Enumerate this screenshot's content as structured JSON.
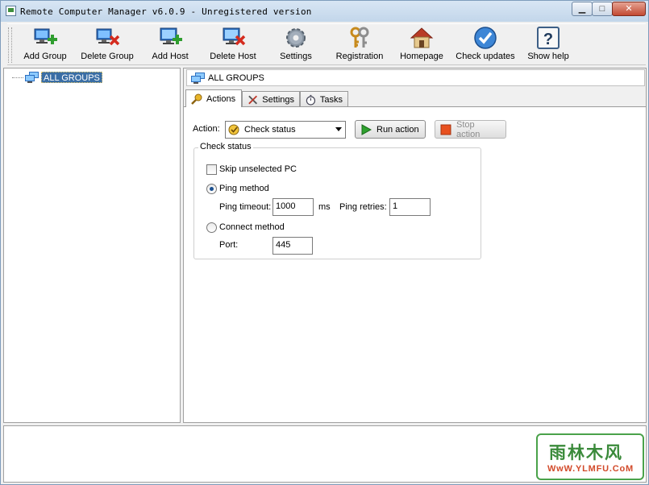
{
  "window": {
    "title": "Remote Computer Manager v6.0.9 - Unregistered version",
    "controls": {
      "minimize": "▁",
      "maximize": "□",
      "close": "✕"
    }
  },
  "toolbar": {
    "items": [
      {
        "label": "Add Group",
        "icon": "add-group-icon"
      },
      {
        "label": "Delete Group",
        "icon": "delete-group-icon"
      },
      {
        "label": "Add Host",
        "icon": "add-host-icon"
      },
      {
        "label": "Delete Host",
        "icon": "delete-host-icon"
      },
      {
        "label": "Settings",
        "icon": "gear-icon"
      },
      {
        "label": "Registration",
        "icon": "keys-icon"
      },
      {
        "label": "Homepage",
        "icon": "home-icon"
      },
      {
        "label": "Check updates",
        "icon": "check-icon"
      },
      {
        "label": "Show help",
        "icon": "help-icon"
      }
    ]
  },
  "tree": {
    "root_label": "ALL GROUPS"
  },
  "path_bar": {
    "label": "ALL GROUPS"
  },
  "tabs": [
    {
      "label": "Actions",
      "active": true
    },
    {
      "label": "Settings",
      "active": false
    },
    {
      "label": "Tasks",
      "active": false
    }
  ],
  "actions": {
    "action_label": "Action:",
    "selected_action": "Check status",
    "run_label": "Run action",
    "stop_label": "Stop action",
    "group_title": "Check status",
    "skip_unselected_label": "Skip unselected PC",
    "skip_unselected_checked": false,
    "ping_method_label": "Ping method",
    "ping_method_selected": true,
    "ping_timeout_label": "Ping timeout:",
    "ping_timeout_value": "1000",
    "ms_label": "ms",
    "ping_retries_label": "Ping retries:",
    "ping_retries_value": "1",
    "connect_method_label": "Connect method",
    "connect_method_selected": false,
    "port_label": "Port:",
    "port_value": "445"
  },
  "watermark": {
    "title": "雨林木风",
    "url": "WwW.YLMFU.CoM"
  }
}
